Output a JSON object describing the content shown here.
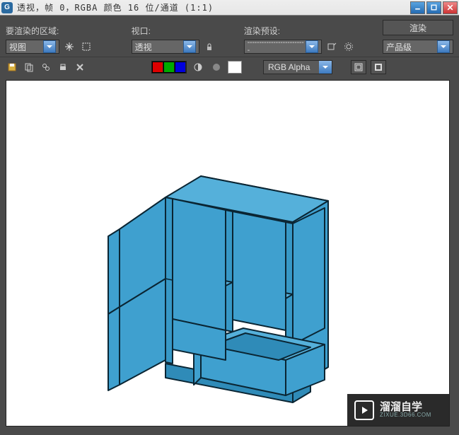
{
  "window": {
    "title": "透视，帧 0，RGBA 颜色 16 位/通道 (1:1)"
  },
  "toolbar": {
    "area_label": "要渲染的区域:",
    "area_value": "视图",
    "viewport_label": "视口:",
    "viewport_value": "透视",
    "preset_label": "渲染预设:",
    "preset_value": "-------------------------",
    "quality_value": "产品级",
    "render_label": "渲染"
  },
  "row2": {
    "channel_value": "RGB Alpha"
  },
  "watermark": {
    "main": "溜溜自学",
    "sub": "ZIXUE.3D66.COM"
  },
  "colors": {
    "cabinet_fill": "#3fa0cf",
    "cabinet_stroke": "#0a2533"
  }
}
